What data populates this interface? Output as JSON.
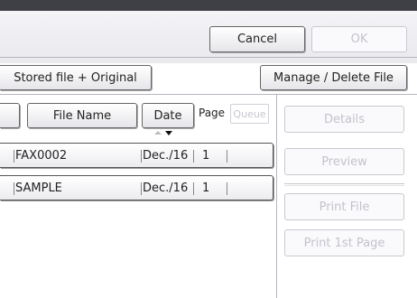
{
  "toolbar": {
    "cancel_label": "Cancel",
    "ok_label": "OK"
  },
  "actions": {
    "stored_original_label": "Stored file + Original",
    "manage_delete_label": "Manage / Delete File"
  },
  "table": {
    "columns": {
      "file_name": "File Name",
      "date": "Date",
      "page": "Page",
      "queue": "Queue"
    },
    "rows": [
      {
        "file_name": "FAX0002",
        "date": "Dec./16",
        "page": "1"
      },
      {
        "file_name": "SAMPLE",
        "date": "Dec./16",
        "page": "1"
      }
    ]
  },
  "side_panel": {
    "details_label": "Details",
    "preview_label": "Preview",
    "print_file_label": "Print File",
    "print_1st_page_label": "Print 1st Page"
  }
}
